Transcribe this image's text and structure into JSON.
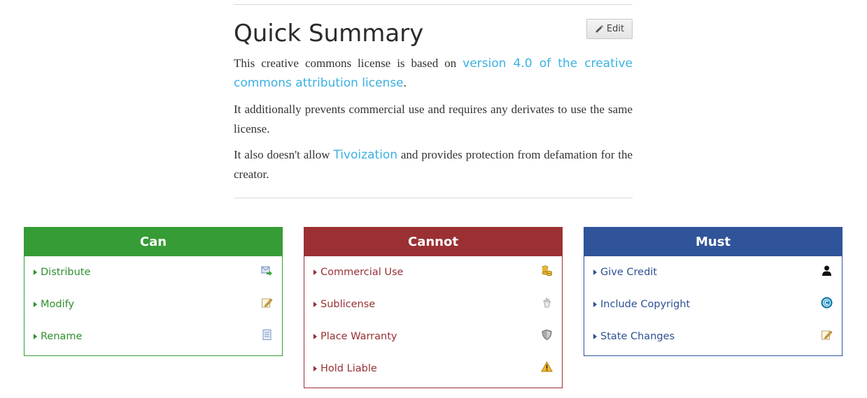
{
  "summary": {
    "title": "Quick Summary",
    "edit_label": "Edit",
    "p1_before": "This creative commons license is based on ",
    "p1_link": "version 4.0 of the creative commons attribution license",
    "p1_after": ".",
    "p2": "It additionally prevents commercial use and requires any derivates to use the same license.",
    "p3_before": "It also doesn't allow ",
    "p3_link": "Tivoization",
    "p3_after": " and provides protection from defamation for the creator."
  },
  "colors": {
    "can": "#369c36",
    "cannot": "#9b3033",
    "must": "#30549a",
    "link": "#3ab0e2"
  },
  "can": {
    "title": "Can",
    "items": [
      {
        "label": "Distribute",
        "icon": "distribute-icon"
      },
      {
        "label": "Modify",
        "icon": "pencil-note-icon"
      },
      {
        "label": "Rename",
        "icon": "document-icon"
      }
    ]
  },
  "cannot": {
    "title": "Cannot",
    "items": [
      {
        "label": "Commercial Use",
        "icon": "coins-icon"
      },
      {
        "label": "Sublicense",
        "icon": "hand-icon"
      },
      {
        "label": "Place Warranty",
        "icon": "shield-icon"
      },
      {
        "label": "Hold Liable",
        "icon": "warning-icon"
      }
    ]
  },
  "must": {
    "title": "Must",
    "items": [
      {
        "label": "Give Credit",
        "icon": "person-icon"
      },
      {
        "label": "Include Copyright",
        "icon": "copyright-icon"
      },
      {
        "label": "State Changes",
        "icon": "pencil-note-icon"
      }
    ]
  }
}
